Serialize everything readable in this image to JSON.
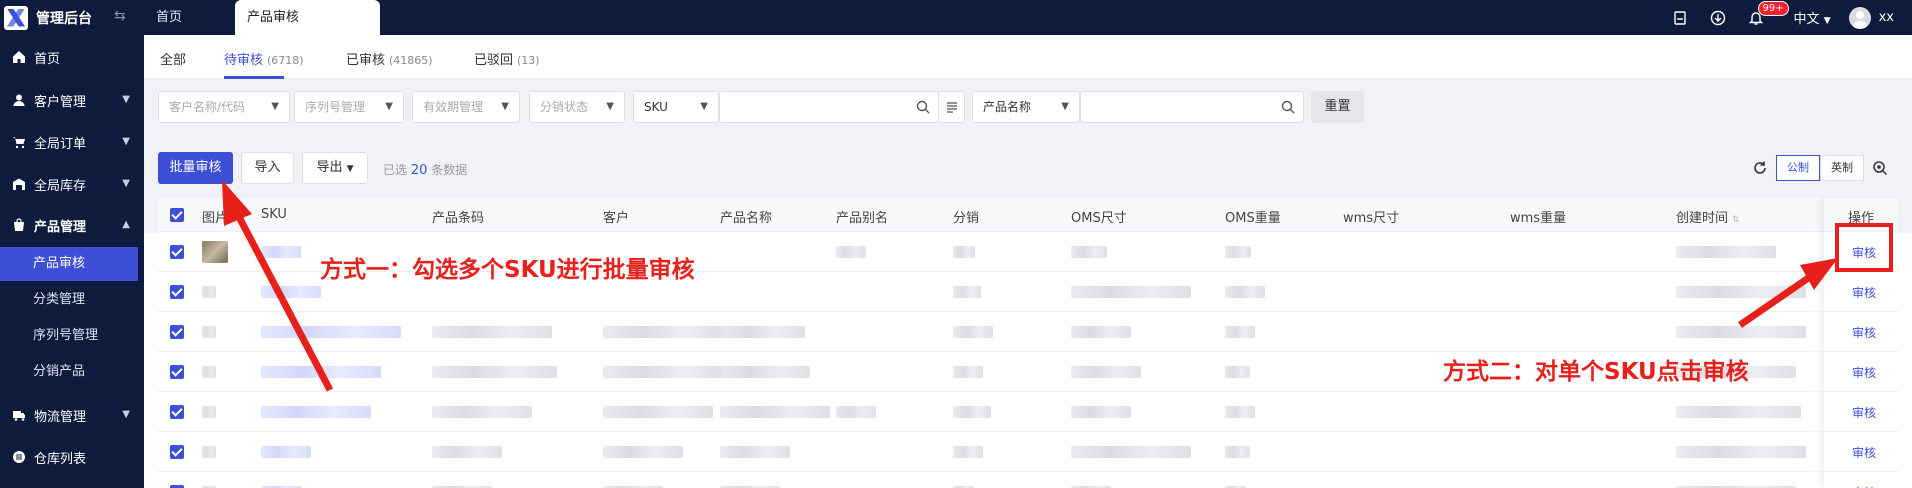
{
  "topbar": {
    "app_title": "管理后台",
    "home_tab": "首页",
    "active_tab": "产品审核",
    "notification_badge": "99+",
    "language": "中文",
    "username": "xx"
  },
  "sidebar": {
    "items": [
      {
        "label": "首页",
        "icon": "home-icon"
      },
      {
        "label": "客户管理",
        "icon": "user-icon"
      },
      {
        "label": "全局订单",
        "icon": "cart-icon"
      },
      {
        "label": "全局库存",
        "icon": "warehouse-icon"
      },
      {
        "label": "产品管理",
        "icon": "bag-icon"
      },
      {
        "label": "物流管理",
        "icon": "truck-icon"
      },
      {
        "label": "仓库列表",
        "icon": "list-icon"
      }
    ],
    "sub_items": [
      "产品审核",
      "分类管理",
      "序列号管理",
      "分销产品"
    ]
  },
  "status_tabs": [
    {
      "label": "全部",
      "count": ""
    },
    {
      "label": "待审核",
      "count": "(6718)"
    },
    {
      "label": "已审核",
      "count": "(41865)"
    },
    {
      "label": "已驳回",
      "count": "(13)"
    }
  ],
  "filters": {
    "customer_placeholder": "客户名称/代码",
    "serial_placeholder": "序列号管理",
    "validity_placeholder": "有效期管理",
    "distribution_placeholder": "分销状态",
    "sku_select": "SKU",
    "name_select": "产品名称",
    "reset_label": "重置"
  },
  "actions": {
    "batch_review": "批量审核",
    "import": "导入",
    "export": "导出",
    "selected_prefix": "已选",
    "selected_count": "20",
    "selected_suffix": "条数据",
    "unit_metric": "公制",
    "unit_imperial": "英制"
  },
  "table": {
    "columns": [
      "图片",
      "SKU",
      "产品条码",
      "客户",
      "产品名称",
      "产品别名",
      "分销",
      "OMS尺寸",
      "OMS重量",
      "wms尺寸",
      "wms重量",
      "创建时间",
      "操作"
    ],
    "row_action": "审核",
    "visible_rows": 7
  },
  "annotations": {
    "method_one": "方式一：勾选多个SKU进行批量审核",
    "method_two": "方式二：对单个SKU点击审核"
  },
  "colors": {
    "nav_bg": "#0f1b3d",
    "accent": "#3d4fd6",
    "annotation_red": "#e8201c"
  }
}
